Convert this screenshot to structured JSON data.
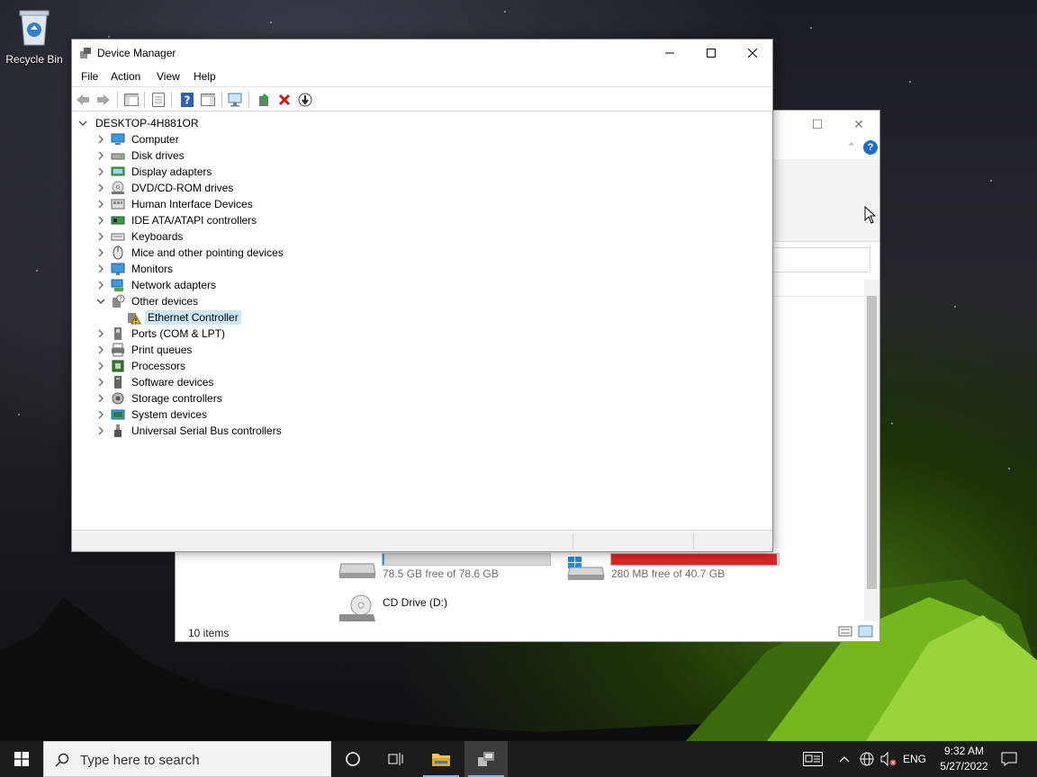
{
  "desktop": {
    "recycle_bin_label": "Recycle Bin"
  },
  "explorer": {
    "status_items": "10 items",
    "drive_c_free": "78.5 GB free of 78.6 GB",
    "drive_c_used_fraction": 0.01,
    "drive_e_free": "280 MB free of 40.7 GB",
    "drive_e_used_fraction": 0.99,
    "cd_drive_label": "CD Drive (D:)",
    "colors": {
      "normal_bar": "#d9d9d9",
      "full_bar": "#da2626"
    }
  },
  "device_manager": {
    "title": "Device Manager",
    "menu": [
      "File",
      "Action",
      "View",
      "Help"
    ],
    "toolbar_icons": [
      "back-icon",
      "forward-icon",
      "show-hide-console-tree-icon",
      "properties-icon",
      "help-icon",
      "action-pane-icon",
      "scan-hardware-icon",
      "update-driver-icon",
      "uninstall-device-icon",
      "disable-device-icon"
    ],
    "tree": {
      "root": "DESKTOP-4H881OR",
      "categories": [
        {
          "label": "Computer",
          "icon": "computer-icon"
        },
        {
          "label": "Disk drives",
          "icon": "disk-drive-icon"
        },
        {
          "label": "Display adapters",
          "icon": "display-adapter-icon"
        },
        {
          "label": "DVD/CD-ROM drives",
          "icon": "dvd-drive-icon"
        },
        {
          "label": "Human Interface Devices",
          "icon": "hid-icon"
        },
        {
          "label": "IDE ATA/ATAPI controllers",
          "icon": "ide-controller-icon"
        },
        {
          "label": "Keyboards",
          "icon": "keyboard-icon"
        },
        {
          "label": "Mice and other pointing devices",
          "icon": "mouse-icon"
        },
        {
          "label": "Monitors",
          "icon": "monitor-icon"
        },
        {
          "label": "Network adapters",
          "icon": "network-adapter-icon"
        },
        {
          "label": "Other devices",
          "icon": "other-devices-icon",
          "expanded": true
        },
        {
          "label": "Ethernet Controller",
          "icon": "warning-device-icon",
          "child": true,
          "selected": true
        },
        {
          "label": "Ports (COM & LPT)",
          "icon": "port-icon"
        },
        {
          "label": "Print queues",
          "icon": "printer-icon"
        },
        {
          "label": "Processors",
          "icon": "processor-icon"
        },
        {
          "label": "Software devices",
          "icon": "software-device-icon"
        },
        {
          "label": "Storage controllers",
          "icon": "storage-controller-icon"
        },
        {
          "label": "System devices",
          "icon": "system-device-icon"
        },
        {
          "label": "Universal Serial Bus controllers",
          "icon": "usb-icon"
        }
      ]
    }
  },
  "taskbar": {
    "search_placeholder": "Type here to search",
    "language": "ENG",
    "time": "9:32 AM",
    "date": "5/27/2022"
  }
}
